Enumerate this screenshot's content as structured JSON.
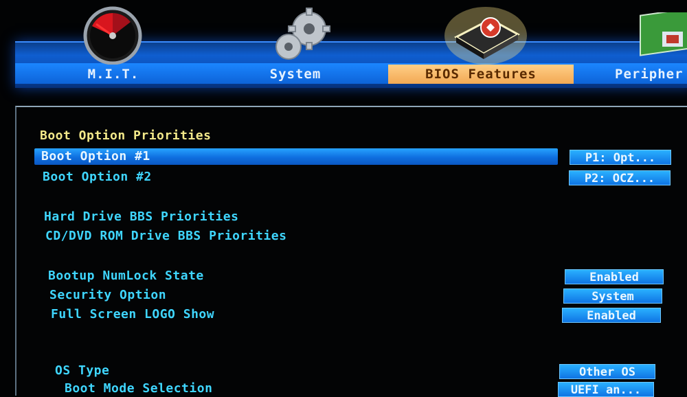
{
  "tabs": [
    {
      "label": "M.I.T.",
      "icon": "speedometer-icon"
    },
    {
      "label": "System",
      "icon": "gears-icon"
    },
    {
      "label": "BIOS Features",
      "icon": "chip-icon",
      "active": true
    },
    {
      "label": "Peripher",
      "icon": "card-icon"
    }
  ],
  "section_title": "Boot Option Priorities",
  "boot_options": [
    {
      "label": "Boot Option #1",
      "value": "P1: Opt...",
      "selected": true
    },
    {
      "label": "Boot Option #2",
      "value": "P2: OCZ..."
    }
  ],
  "submenus": [
    {
      "label": "Hard Drive BBS Priorities"
    },
    {
      "label": "CD/DVD ROM Drive BBS Priorities"
    }
  ],
  "settings": [
    {
      "label": "Bootup NumLock State",
      "value": "Enabled"
    },
    {
      "label": "Security Option",
      "value": "System"
    },
    {
      "label": "Full Screen LOGO Show",
      "value": "Enabled"
    }
  ],
  "os_settings": [
    {
      "label": "OS Type",
      "value": "Other OS"
    },
    {
      "label": "Boot Mode Selection",
      "value": "UEFI an..."
    }
  ],
  "colors": {
    "tab_bar": "#0f5ed0",
    "active_tab": "#f2a854",
    "item_text": "#3fd6ff",
    "heading_text": "#f3e98a",
    "value_box": "#0f74e4"
  }
}
